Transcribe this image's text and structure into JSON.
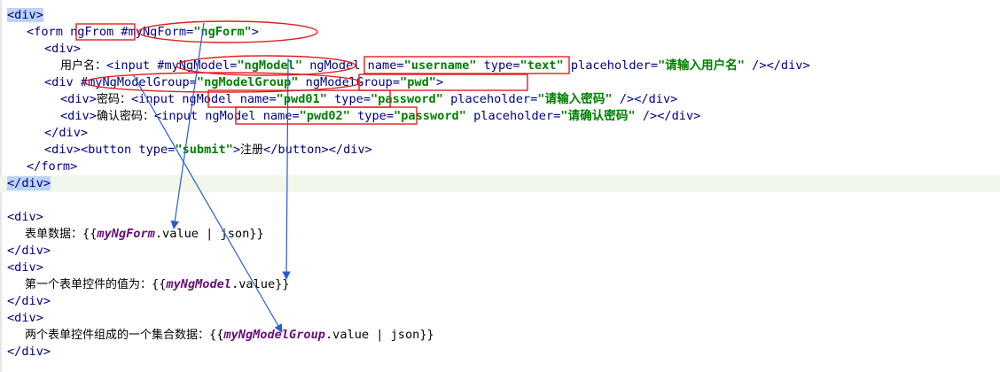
{
  "code_lines": [
    {
      "text": "<div>"
    },
    {
      "text": "<form ngFrom #myNgForm=\"ngForm\">"
    },
    {
      "text": "<div>"
    },
    {
      "text": "用户名：<input #myNgModel=\"ngModel\" ngModel name=\"username\" type=\"text\" placeholder=\"请输入用户名\" /></div>"
    },
    {
      "text": "<div #myNgModelGroup=\"ngModelGroup\" ngModelGroup=\"pwd\">"
    },
    {
      "text": "<div>密码：<input ngModel name=\"pwd01\" type=\"password\" placeholder=\"请输入密码\" /></div>"
    },
    {
      "text": "<div>确认密码：<input ngModel name=\"pwd02\" type=\"password\" placeholder=\"请确认密码\" /></div>"
    },
    {
      "text": "</div>"
    },
    {
      "text": "<div><button type=\"submit\">注册</button></div>"
    },
    {
      "text": "</form>"
    },
    {
      "text": "</div>"
    },
    {
      "text": ""
    },
    {
      "text": "<div>"
    },
    {
      "text": "表单数据：{{myNgForm.value | json}}"
    },
    {
      "text": "</div>"
    },
    {
      "text": "<div>"
    },
    {
      "text": "第一个表单控件的值为：{{myNgModel.value}}"
    },
    {
      "text": "</div>"
    },
    {
      "text": "<div>"
    },
    {
      "text": "两个表单控件组成的一个集合数据：{{myNgModelGroup.value | json}}"
    },
    {
      "text": "</div>"
    }
  ],
  "colors": {
    "tag": "#000080",
    "attribute_value": "#008000",
    "template_variable": "#660e7a",
    "annotation_red": "#e02020",
    "annotation_arrow": "#2a5bd7",
    "selection": "#bcd3f5",
    "line_shade": "#f1f6ea"
  },
  "annotations": {
    "red_boxes": [
      "ngFrom",
      "ngModel name=\"username\"",
      "ngModelGroup=\"pwd\"",
      "ngModel name=\"pwd01\"",
      "ngModel name=\"pwd02\""
    ],
    "red_ellipses": [
      "#myNgForm=\"ngForm\"",
      "#myNgModel=\"ngModel\"",
      "#myNgModelGroup=\"ngModelGroup\""
    ],
    "arrows": [
      "#myNgForm -> myNgForm.value",
      "#myNgModel -> myNgModel.value",
      "#myNgModelGroup -> myNgModelGroup.value"
    ]
  }
}
